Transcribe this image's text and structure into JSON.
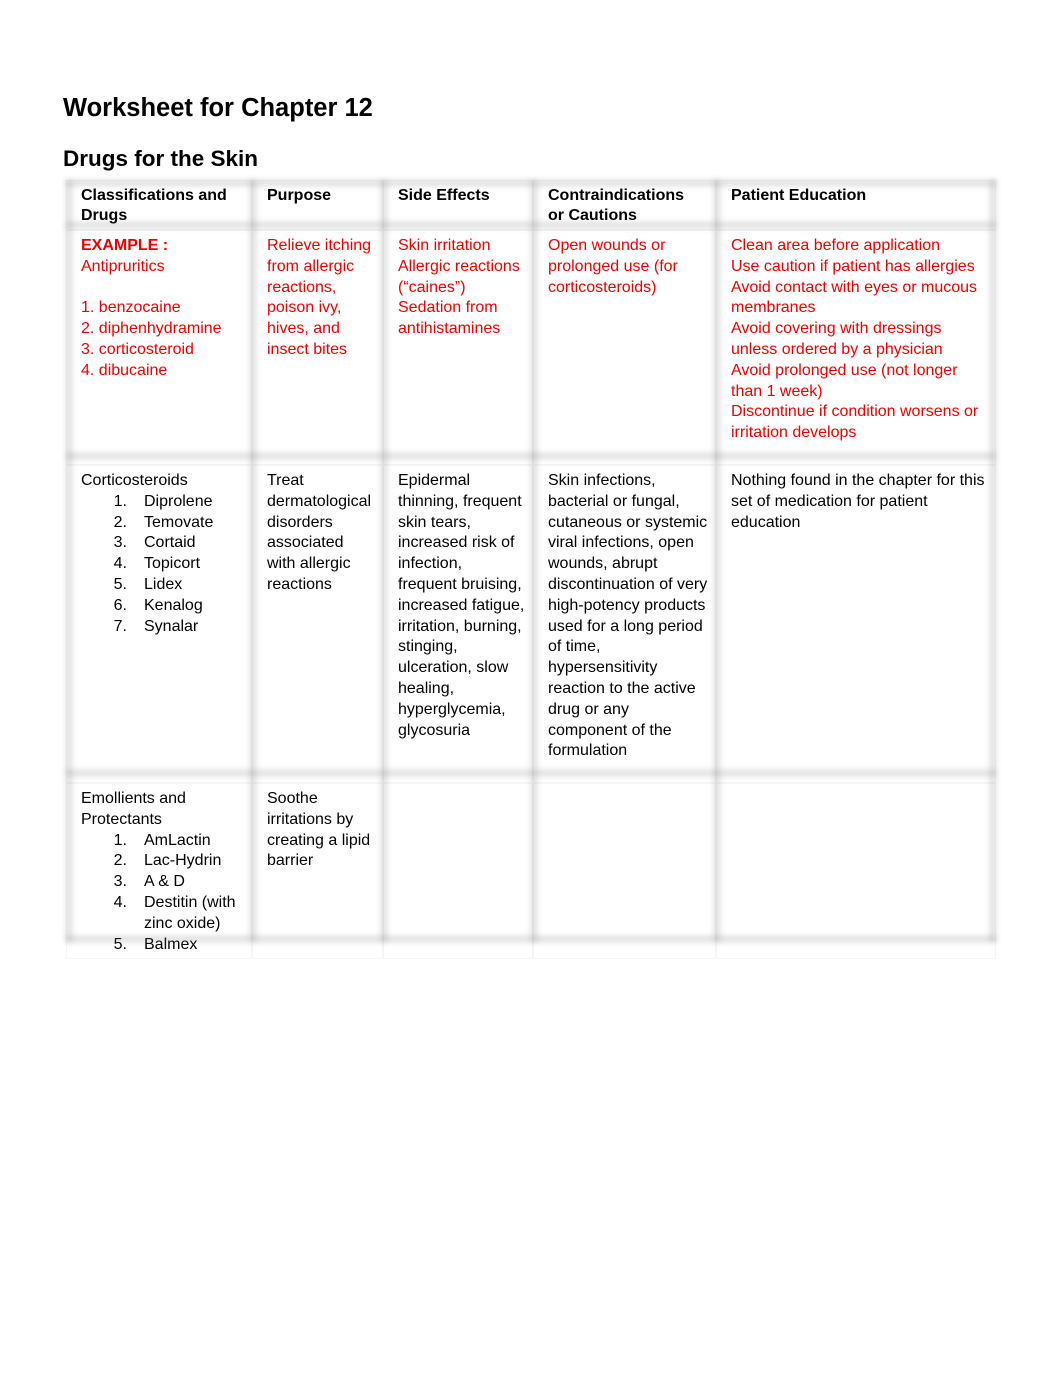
{
  "page": {
    "title": "Worksheet for Chapter 12",
    "subtitle": "Drugs for the Skin"
  },
  "table": {
    "headers": [
      {
        "label_line1": "Classifications and",
        "label_line2": "Drugs"
      },
      {
        "label_line1": "Purpose",
        "label_line2": ""
      },
      {
        "label_line1": "Side Effects",
        "label_line2": ""
      },
      {
        "label_line1": "Contraindications",
        "label_line2": "or Cautions"
      },
      {
        "label_line1": "Patient Education",
        "label_line2": ""
      }
    ],
    "example_row": {
      "label": "EXAMPLE :",
      "classification": "Antipruritics",
      "drugs": [
        "1. benzocaine",
        "2. diphenhydramine",
        "3. corticosteroid",
        "4. dibucaine"
      ],
      "purpose": "Relieve itching from allergic reactions, poison ivy, hives, and insect bites",
      "side_effects": [
        "Skin irritation",
        "Allergic reactions (“caines”)",
        "Sedation from antihistamines"
      ],
      "contraindications": "Open wounds or prolonged use (for corticosteroids)",
      "patient_education": [
        "Clean area before application",
        "Use caution if patient has allergies",
        "Avoid contact with eyes or mucous membranes",
        "Avoid covering with dressings unless ordered by a physician",
        "Avoid prolonged use (not longer than 1 week)",
        "Discontinue if condition worsens or irritation develops"
      ]
    },
    "rows": [
      {
        "classification": "Corticosteroids",
        "drugs": [
          {
            "num": "1.",
            "name": "Diprolene"
          },
          {
            "num": "2.",
            "name": "Temovate"
          },
          {
            "num": "3.",
            "name": "Cortaid"
          },
          {
            "num": "4.",
            "name": "Topicort"
          },
          {
            "num": "5.",
            "name": "Lidex"
          },
          {
            "num": "6.",
            "name": "Kenalog"
          },
          {
            "num": "7.",
            "name": "Synalar"
          }
        ],
        "purpose": "Treat dermatological disorders associated with allergic reactions",
        "side_effects": "Epidermal thinning, frequent skin tears, increased risk of infection, frequent bruising, increased fatigue, irritation, burning, stinging, ulceration, slow healing, hyperglycemia, glycosuria",
        "contraindications": "Skin infections, bacterial or fungal, cutaneous or systemic viral infections, open wounds, abrupt discontinuation of very high-potency products used for a long period of time, hypersensitivity reaction to the active drug or any component of the formulation",
        "patient_education": "Nothing found in the chapter for this set of medication for patient education"
      },
      {
        "classification": "Emollients and Protectants",
        "drugs": [
          {
            "num": "1.",
            "name": "AmLactin"
          },
          {
            "num": "2.",
            "name": "Lac-Hydrin"
          },
          {
            "num": "3.",
            "name": "A & D"
          },
          {
            "num": "4.",
            "name": "Destitin (with zinc oxide)"
          },
          {
            "num": "5.",
            "name": "Balmex"
          }
        ],
        "purpose": "Soothe irritations by creating a lipid barrier",
        "side_effects": "",
        "contraindications": "",
        "patient_education": ""
      }
    ]
  },
  "colors": {
    "example_text": "#ee0000",
    "body_text": "#000000"
  }
}
